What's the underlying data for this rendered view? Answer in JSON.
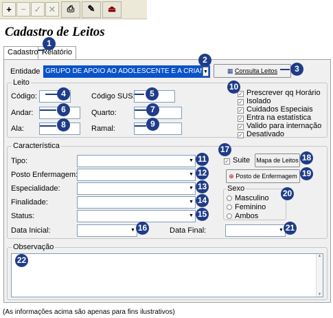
{
  "toolbar": {
    "icons": [
      "plus-icon",
      "minus-icon",
      "check-icon",
      "x-icon",
      "printer-icon",
      "edit-icon",
      "exit-icon"
    ]
  },
  "title": "Cadastro de Leitos",
  "tabs": [
    "Cadastro",
    "Relatório"
  ],
  "entidade": {
    "label": "Entidade",
    "value": "GRUPO DE APOIO AO ADOLESCENTE E A CRIAN",
    "button": "Consulta Leitos"
  },
  "leito": {
    "title": "Leito",
    "codigo": "Código:",
    "codigo_sus": "Código SUS:",
    "andar": "Andar:",
    "quarto": "Quarto:",
    "ala": "Ala:",
    "ramal": "Ramal:",
    "checks": [
      "Prescrever qq Horário",
      "Isolado",
      "Cuidados Especiais",
      "Entra na estatística",
      "Valido para internação",
      "Desativado"
    ]
  },
  "caracteristica": {
    "title": "Característica",
    "tipo": "Tipo:",
    "posto": "Posto Enfermagem:",
    "especialidade": "Especialidade:",
    "finalidade": "Finalidade:",
    "status": "Status:",
    "data_inicial": "Data Inicial:",
    "data_final": "Data Final:",
    "suite": "Suite",
    "mapa": "Mapa de Leitos",
    "posto_btn": "Posto de Enfermagem",
    "sexo": {
      "title": "Sexo",
      "options": [
        "Masculino",
        "Feminino",
        "Ambos"
      ]
    }
  },
  "observacao": {
    "title": "Observação"
  },
  "badges": [
    "1",
    "2",
    "3",
    "4",
    "5",
    "6",
    "7",
    "8",
    "9",
    "10",
    "11",
    "12",
    "13",
    "14",
    "15",
    "16",
    "17",
    "18",
    "19",
    "20",
    "21",
    "22"
  ],
  "footer": "(As informações acima são apenas para fins ilustrativos)"
}
